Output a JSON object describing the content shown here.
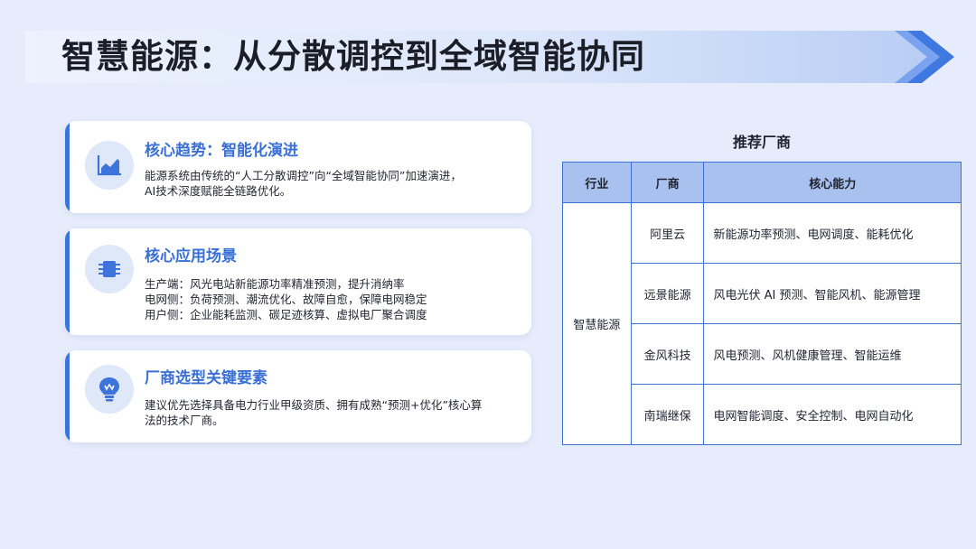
{
  "page": {
    "title": "智慧能源：从分散调控到全域智能协同"
  },
  "cards": [
    {
      "icon": "chart-icon",
      "title": "核心趋势：智能化演进",
      "lines": [
        "能源系统由传统的“人工分散调控”向“全域智能协同”加速演进，",
        "AI技术深度赋能全链路优化。"
      ]
    },
    {
      "icon": "chip-icon",
      "title": "核心应用场景",
      "lines": [
        "生产端：风光电站新能源功率精准预测，提升消纳率",
        "电网侧：负荷预测、潮流优化、故障自愈，保障电网稳定",
        "用户侧：企业能耗监测、碳足迹核算、虚拟电厂聚合调度"
      ]
    },
    {
      "icon": "lightbulb-icon",
      "title": "厂商选型关键要素",
      "lines": [
        "建议优先选择具备电力行业甲级资质、拥有成熟“预测+优化”核心算",
        "法的技术厂商。"
      ]
    }
  ],
  "vendor_table": {
    "title": "推荐厂商",
    "headers": [
      "行业",
      "厂商",
      "核心能力"
    ],
    "industry": "智慧能源",
    "rows": [
      {
        "vendor": "阿里云",
        "capability": "新能源功率预测、电网调度、能耗优化"
      },
      {
        "vendor": "远景能源",
        "capability": "风电光伏 AI 预测、智能风机、能源管理"
      },
      {
        "vendor": "金风科技",
        "capability": "风电预测、风机健康管理、智能运维"
      },
      {
        "vendor": "南瑞继保",
        "capability": "电网智能调度、安全控制、电网自动化"
      }
    ]
  },
  "colors": {
    "accent": "#3c74dc",
    "background": "#e6ecfb",
    "table_header": "#a9c1ee"
  }
}
